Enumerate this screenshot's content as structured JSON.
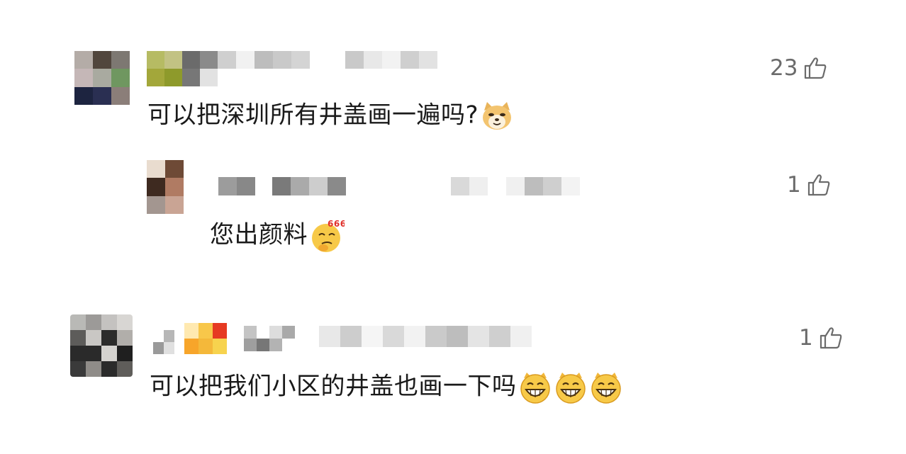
{
  "comments": [
    {
      "text": "可以把深圳所有井盖画一遍吗?",
      "likes": "23",
      "emoji": "doge-emoji",
      "reply": {
        "text": "您出颜料",
        "likes": "1",
        "emoji": "666-emoji"
      }
    },
    {
      "text": "可以把我们小区的井盖也画一下吗",
      "likes": "1",
      "emoji": "grin-emoji"
    }
  ],
  "colors": {
    "like_icon": "#6b6b6b",
    "text": "#1a1a1a",
    "background": "#ffffff"
  }
}
